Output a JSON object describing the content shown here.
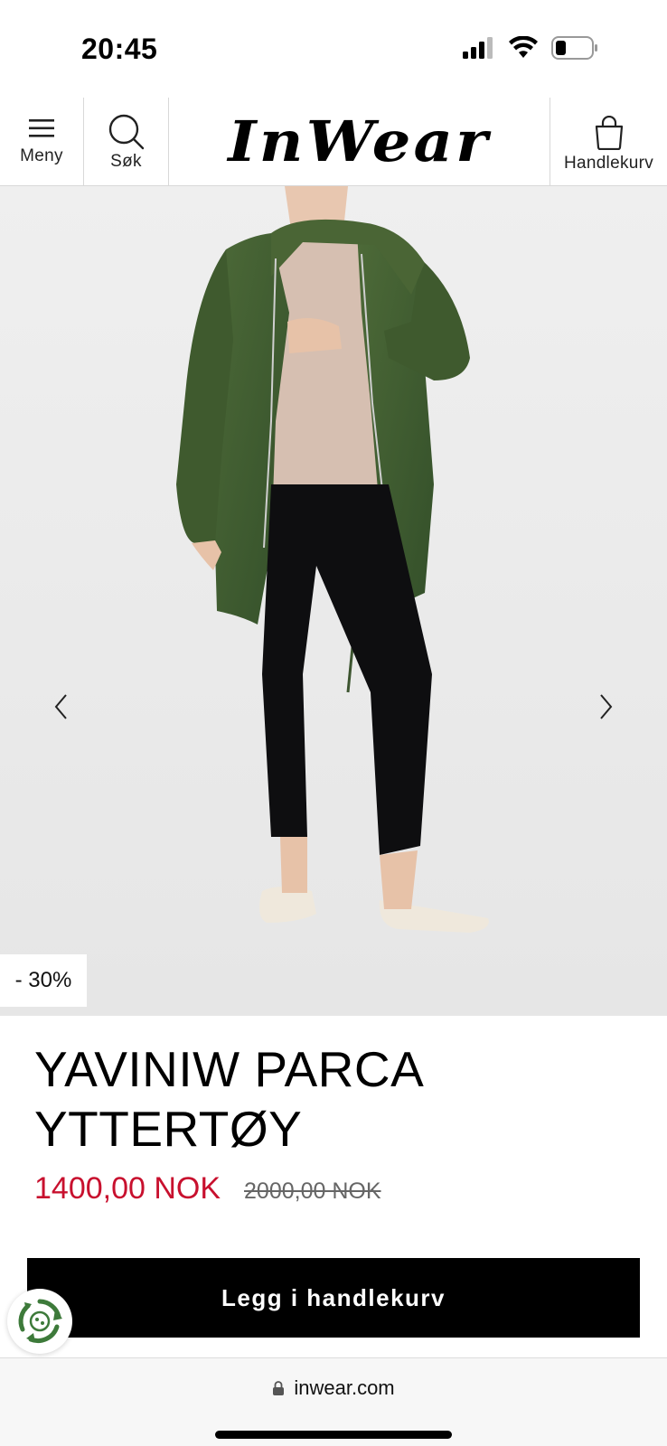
{
  "status_bar": {
    "time": "20:45"
  },
  "header": {
    "menu_label": "Meny",
    "search_label": "Søk",
    "logo_text": "InWear",
    "cart_label": "Handlekurv"
  },
  "product": {
    "discount_badge": "- 30%",
    "title": "YAVINIW PARCA YTTERTØY",
    "price_sale": "1400,00 NOK",
    "price_original": "2000,00 NOK",
    "add_to_cart_label": "Legg i handlekurv"
  },
  "browser": {
    "url": "inwear.com"
  },
  "colors": {
    "sale_price": "#c8102e",
    "button_bg": "#000000",
    "jacket_green": "#3f5a2e",
    "eco_green": "#3d7a3a"
  },
  "icons": [
    "menu-icon",
    "search-icon",
    "cart-bag-icon",
    "chevron-left-icon",
    "chevron-right-icon",
    "eco-recycle-icon",
    "lock-icon"
  ]
}
